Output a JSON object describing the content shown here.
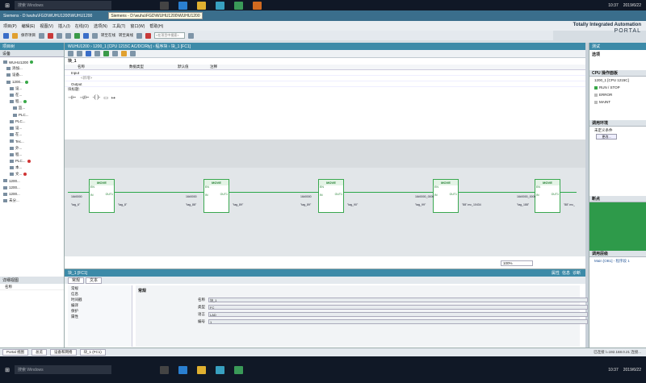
{
  "taskbar_top": {
    "search": "搜索 Windows",
    "time": "10:37",
    "date": "2019/6/22"
  },
  "titlebar": {
    "title": "Siemens - D:\\wuhu\\FGD\\WUHU1200\\WUHU1200",
    "tooltip": "Siemens - D:\\wuhu\\FGD\\WUHU1200\\WUHU1200"
  },
  "menu": [
    "项目(P)",
    "编辑(E)",
    "视图(V)",
    "插入(I)",
    "在线(O)",
    "选项(N)",
    "工具(T)",
    "窗口(W)",
    "帮助(H)"
  ],
  "brand": {
    "line1": "Totally Integrated Automation",
    "line2": "PORTAL"
  },
  "toolbar": {
    "save": "保存项目",
    "online": "转至在线",
    "offline": "转至离线",
    "search_placeholder": "<在项目中搜索>"
  },
  "left": {
    "header": "项目树",
    "tab": "设备",
    "items": [
      "WUHU1200",
      "添加...",
      "设备...",
      "1200...",
      "设...",
      "在...",
      "程...",
      "监...",
      "PLC...",
      "PLC...",
      "设...",
      "在...",
      "Tec...",
      "外...",
      "程...",
      "PLC...",
      "本...",
      "文...",
      "1200...",
      "1200...",
      "1200...",
      "未分..."
    ],
    "detail_header": "详细视图",
    "detail_col": "名称"
  },
  "editor": {
    "breadcrumb": "WUHU1200 › 1200_1 [CPU 1215C AC/DC/Rly] › 程序块 › 块_1 [FC1]",
    "block": "块_1",
    "cols": [
      "名称",
      "数据类型",
      "默认值",
      "注释"
    ],
    "rows": [
      "Input",
      "<新增>",
      "Output"
    ],
    "title_line": "块标题:",
    "instr": "MOVE",
    "en": "EN",
    "eno": "ENO",
    "in": "IN",
    "out1": "OUT1",
    "zoom": "100%",
    "moves": [
      {
        "in": "16#0000",
        "tag_in": "\"tag_6\"",
        "tag_out": "\"tag_8\""
      },
      {
        "in": "16#0000",
        "tag_in": "\"tag_88\"",
        "tag_out": "\"tag_89\""
      },
      {
        "in": "16#0000",
        "tag_in": "\"tag_89\"",
        "tag_out": "\"tag_90\""
      },
      {
        "in": "16#0000_0000",
        "tag_in": "\"tag_99\"",
        "tag_out": "\"88\".mc_10434"
      },
      {
        "in": "16#0000_0000",
        "tag_in": "\"tag_188\"",
        "tag_out": "\"88\".mc_"
      }
    ]
  },
  "inspector": {
    "header": "块_1 [FC1]",
    "tabs": [
      "常规",
      "文本"
    ],
    "nav": [
      "常规",
      "信息",
      "时间戳",
      "编译",
      "保护",
      "属性"
    ],
    "section": "常规",
    "fields": [
      {
        "label": "名称",
        "value": "块_1"
      },
      {
        "label": "类型",
        "value": "FC"
      },
      {
        "label": "语言",
        "value": "LAD"
      },
      {
        "label": "编号",
        "value": "1"
      }
    ],
    "prop_tabs": [
      "属性",
      "信息",
      "诊断"
    ]
  },
  "task": {
    "header": "测试",
    "title": "选项",
    "sections": [
      "CPU 操作面板",
      "调用环境",
      "断点",
      "调用层级"
    ],
    "cpu": "1200_1 [CPU 1215C]",
    "run": "RUN / STOP",
    "error": "ERROR",
    "maint": "MAINT",
    "env": "未定义条件",
    "btn": "更改...",
    "callstack": "Main [OB1] - 程序段 1"
  },
  "bottom": {
    "portal": "Portal 视图",
    "tabs": [
      "总览",
      "设备和网络",
      "块_1 (FC1)"
    ],
    "status": "已连接 \\=192.168.0.21 连接..."
  }
}
